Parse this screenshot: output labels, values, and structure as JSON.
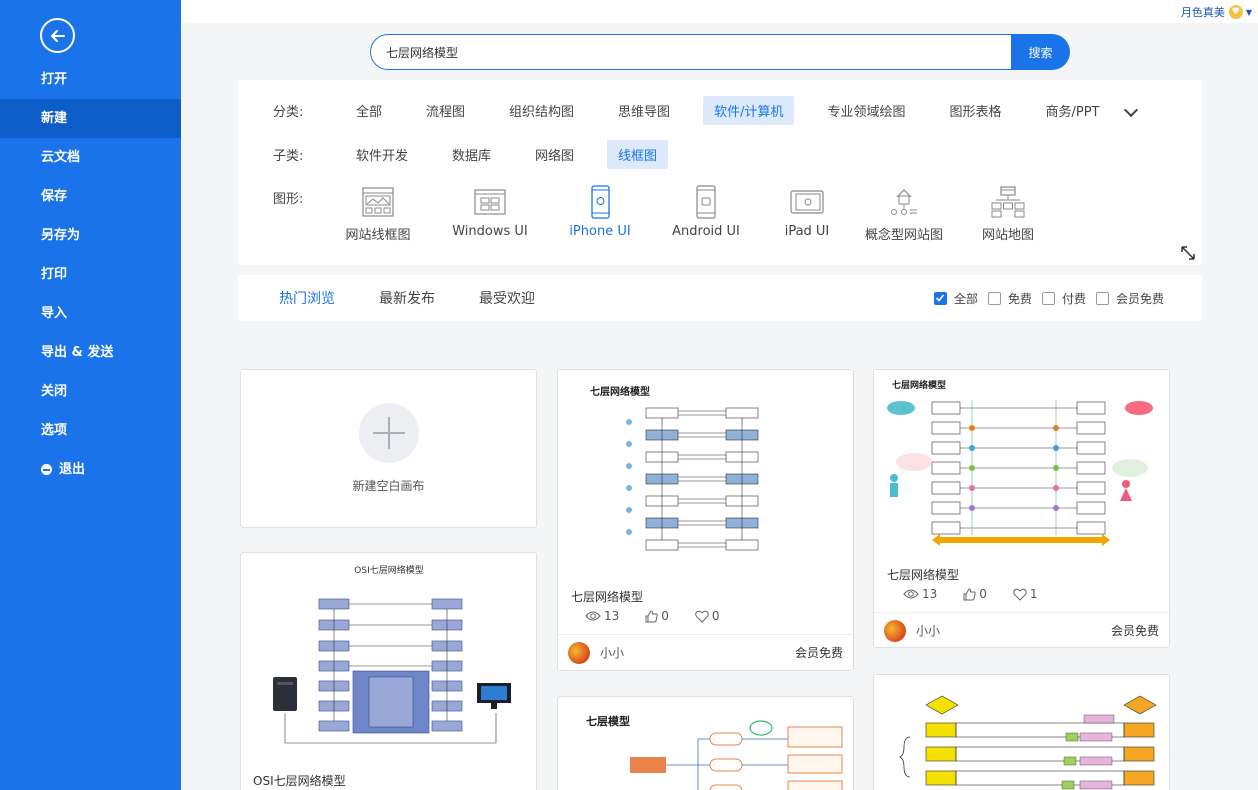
{
  "user": {
    "name": "月色真美"
  },
  "sidebar": {
    "items": [
      {
        "label": "打开"
      },
      {
        "label": "新建"
      },
      {
        "label": "云文档"
      },
      {
        "label": "保存"
      },
      {
        "label": "另存为"
      },
      {
        "label": "打印"
      },
      {
        "label": "导入"
      },
      {
        "label": "导出 & 发送"
      },
      {
        "label": "关闭"
      },
      {
        "label": "选项"
      },
      {
        "label": "退出"
      }
    ],
    "active": "新建"
  },
  "search": {
    "value": "七层网络模型",
    "button": "搜索"
  },
  "filters": {
    "category_label": "分类:",
    "categories": [
      "全部",
      "流程图",
      "组织结构图",
      "思维导图",
      "软件/计算机",
      "专业领域绘图",
      "图形表格",
      "商务/PPT"
    ],
    "category_active": "软件/计算机",
    "sub_label": "子类:",
    "subcategories": [
      "软件开发",
      "数据库",
      "网络图",
      "线框图"
    ],
    "sub_active": "线框图",
    "shape_label": "图形:",
    "shapes": [
      "网站线框图",
      "Windows UI",
      "iPhone UI",
      "Android UI",
      "iPad UI",
      "概念型网站图",
      "网站地图"
    ],
    "shape_active": "iPhone UI"
  },
  "tabs": {
    "items": [
      "热门浏览",
      "最新发布",
      "最受欢迎"
    ],
    "active": "热门浏览"
  },
  "price_filters": [
    {
      "label": "全部",
      "checked": true
    },
    {
      "label": "免费",
      "checked": false
    },
    {
      "label": "付费",
      "checked": false
    },
    {
      "label": "会员免费",
      "checked": false
    }
  ],
  "new_card": {
    "label": "新建空白画布"
  },
  "cards": {
    "osi": {
      "thumb_title": "OSI七层网络模型",
      "title": "OSI七层网络模型"
    },
    "c1": {
      "thumb_title": "七层网络模型",
      "title": "七层网络模型",
      "views": "13",
      "likes": "0",
      "favs": "0",
      "author": "小小",
      "price": "会员免费"
    },
    "c2": {
      "thumb_title": "七层网络模型",
      "title": "七层网络模型",
      "views": "13",
      "likes": "0",
      "favs": "1",
      "author": "小小",
      "price": "会员免费"
    },
    "c3": {
      "thumb_title": "七层模型"
    }
  },
  "colors": {
    "accent": "#1a73e8",
    "sidebar_active": "#0e5ec9"
  }
}
